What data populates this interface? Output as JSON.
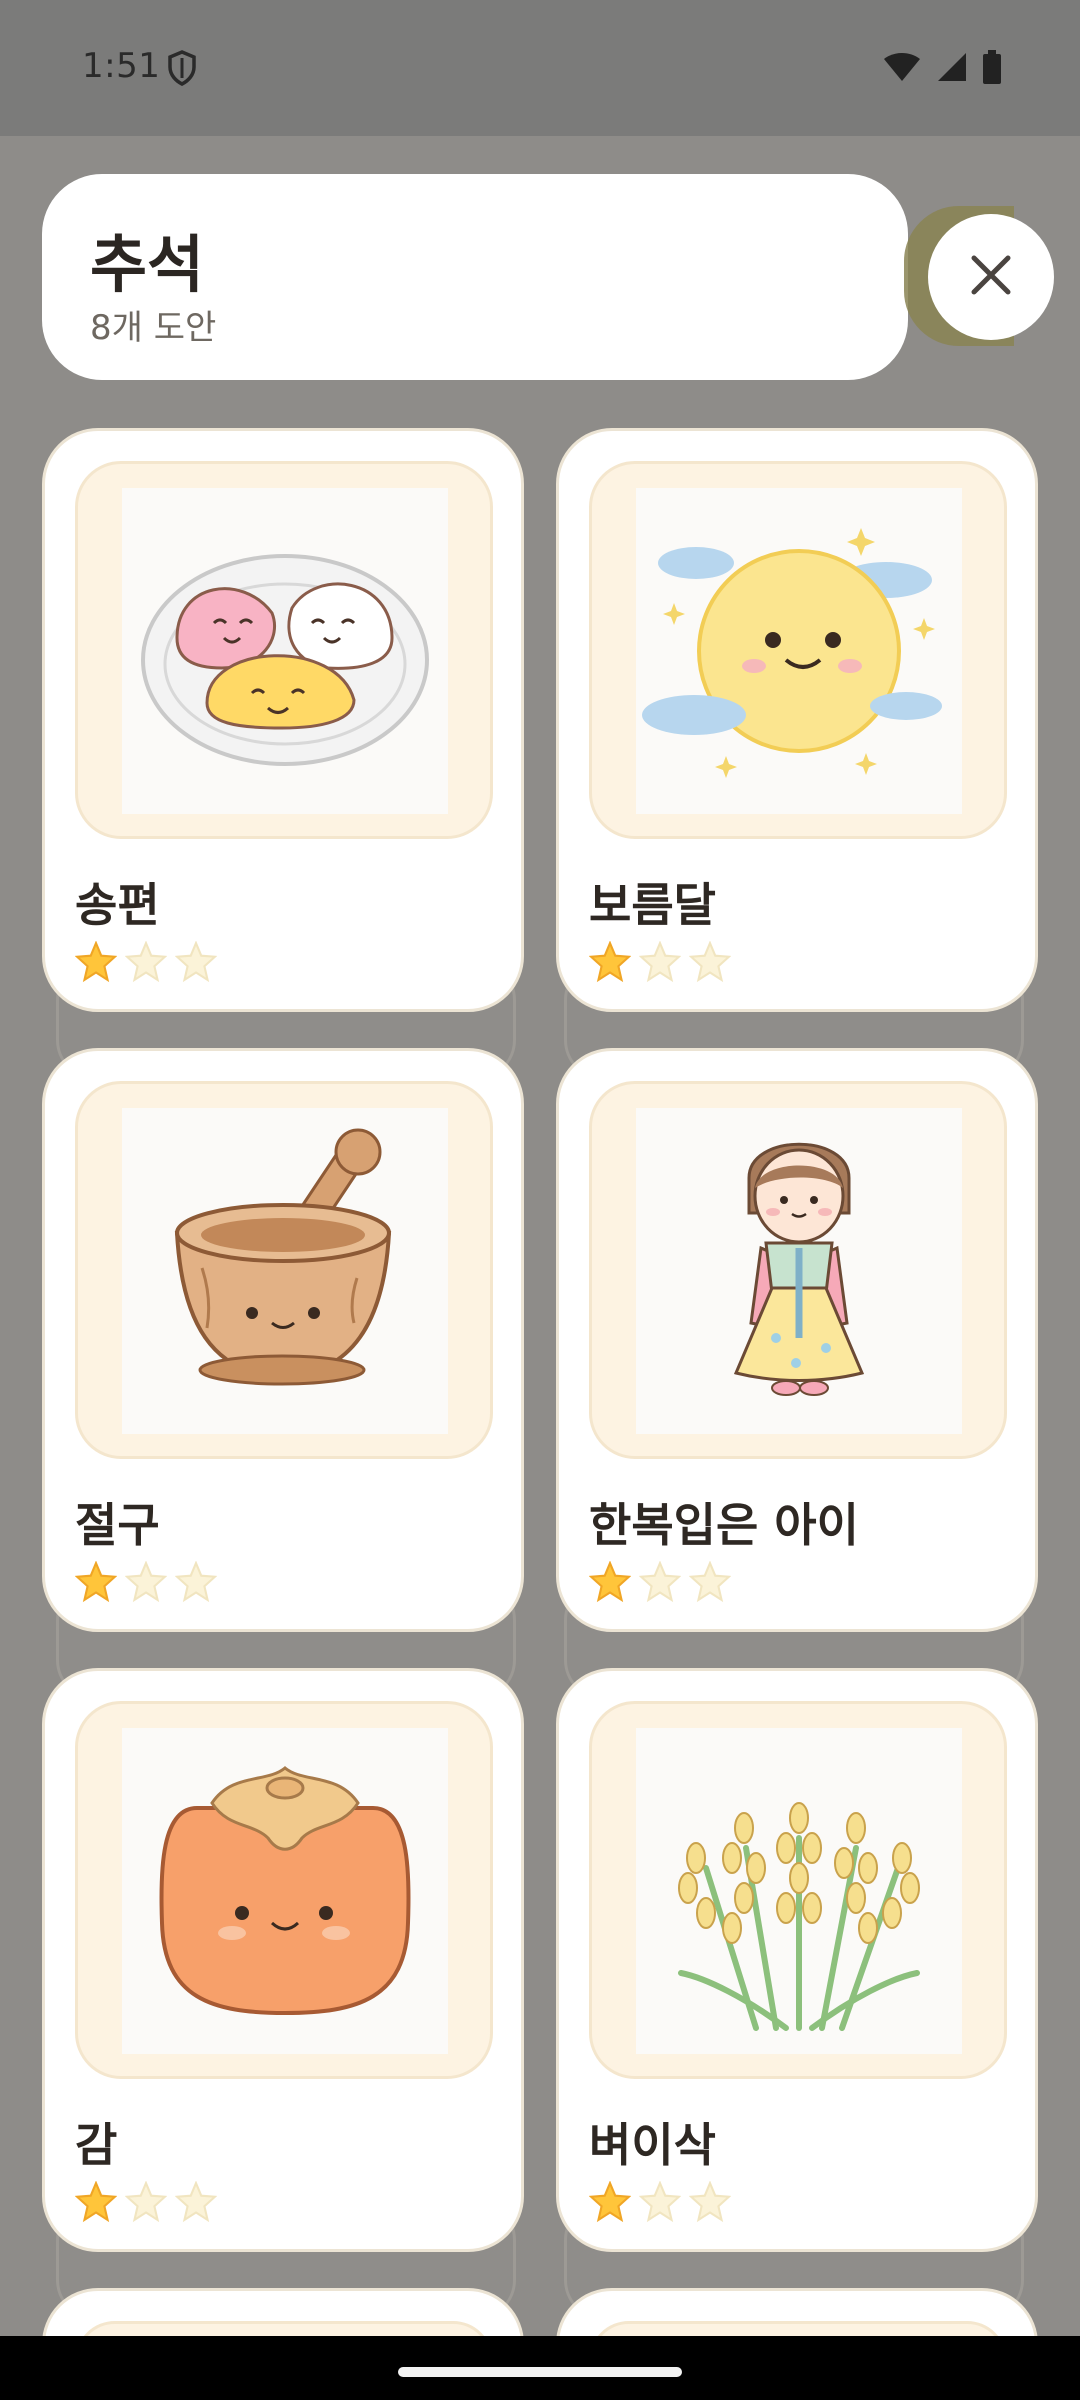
{
  "status_bar": {
    "time": "1:51",
    "icons": [
      "shield-icon",
      "wifi-icon",
      "signal-icon",
      "battery-icon"
    ]
  },
  "header": {
    "title": "추석",
    "subtitle": "8개 도안",
    "close_icon": "close-icon"
  },
  "cards": [
    {
      "name": "송편",
      "stars_filled": 1,
      "stars_total": 3,
      "image": "songpyeon-illustration"
    },
    {
      "name": "보름달",
      "stars_filled": 1,
      "stars_total": 3,
      "image": "full-moon-illustration"
    },
    {
      "name": "절구",
      "stars_filled": 1,
      "stars_total": 3,
      "image": "mortar-illustration"
    },
    {
      "name": "한복입은 아이",
      "stars_filled": 1,
      "stars_total": 3,
      "image": "hanbok-child-illustration"
    },
    {
      "name": "감",
      "stars_filled": 1,
      "stars_total": 3,
      "image": "persimmon-illustration"
    },
    {
      "name": "벼이삭",
      "stars_filled": 1,
      "stars_total": 3,
      "image": "rice-stalk-illustration"
    }
  ],
  "colors": {
    "backdrop": "#8e8c89",
    "card": "#ffffff",
    "frame": "#fdf3e2",
    "star_filled": "#ffc53a",
    "star_empty": "#fbf3d8"
  }
}
